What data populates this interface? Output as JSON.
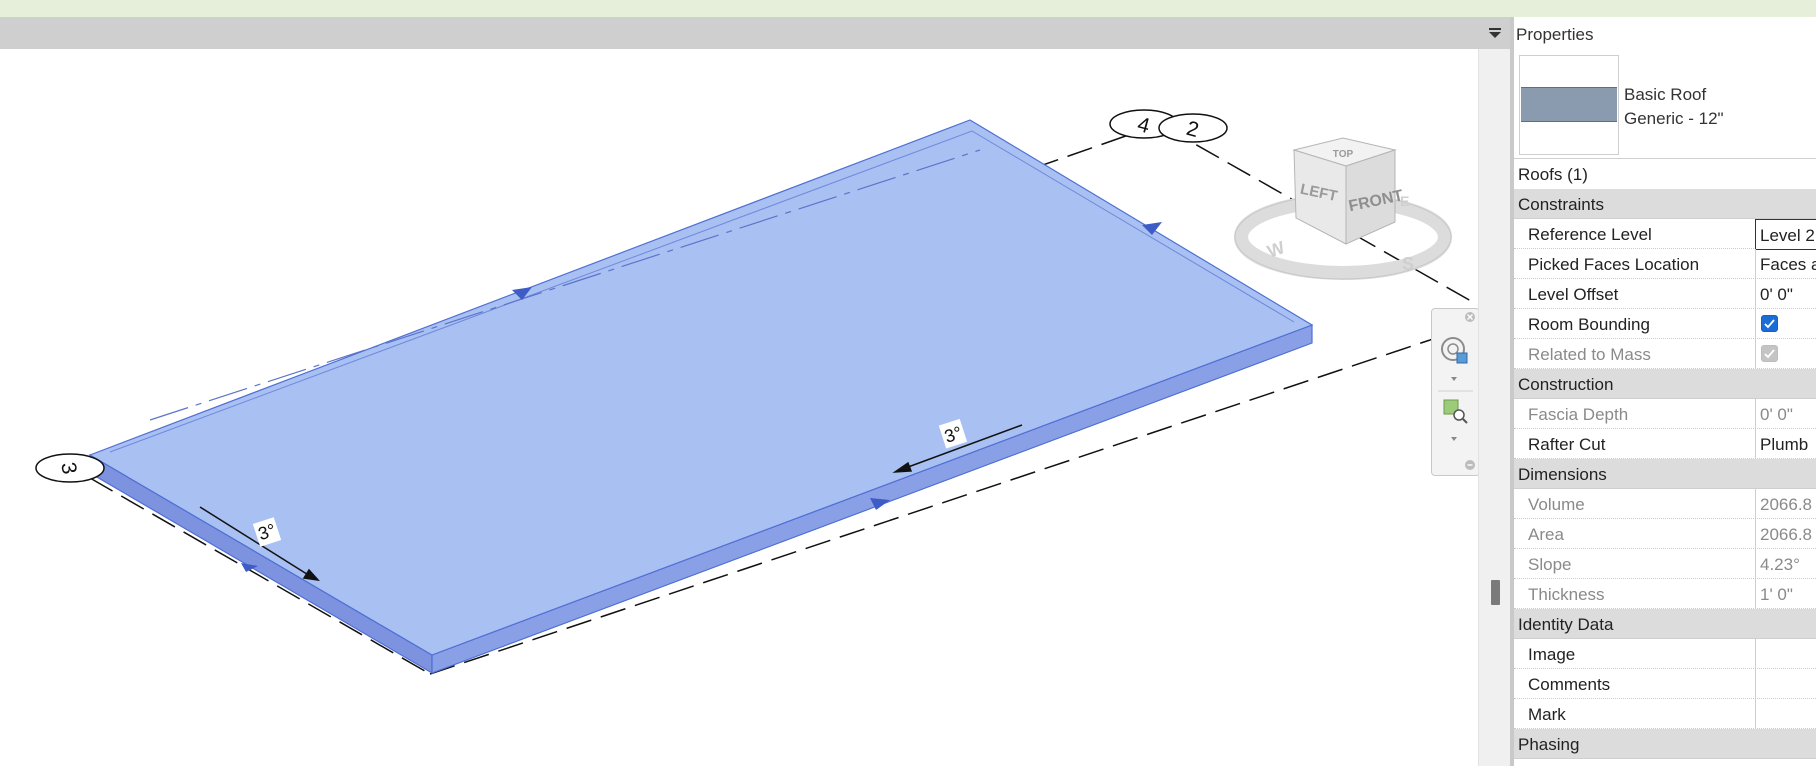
{
  "properties": {
    "title": "Properties",
    "type_family": "Basic Roof",
    "type_name": "Generic - 12\"",
    "selection": "Roofs (1)",
    "groups": [
      {
        "name": "Constraints",
        "rows": [
          {
            "label": "Reference Level",
            "value": "Level 2",
            "editing": true
          },
          {
            "label": "Picked Faces Location",
            "value": "Faces a"
          },
          {
            "label": "Level Offset",
            "value": "0'  0\""
          },
          {
            "label": "Room Bounding",
            "checkbox": "checked"
          },
          {
            "label": "Related to Mass",
            "checkbox": "disabled",
            "readonly": true
          }
        ]
      },
      {
        "name": "Construction",
        "rows": [
          {
            "label": "Fascia Depth",
            "value": "0'  0\"",
            "readonly": true
          },
          {
            "label": "Rafter Cut",
            "value": "Plumb"
          }
        ]
      },
      {
        "name": "Dimensions",
        "rows": [
          {
            "label": "Volume",
            "value": "2066.8",
            "readonly": true
          },
          {
            "label": "Area",
            "value": "2066.8",
            "readonly": true
          },
          {
            "label": "Slope",
            "value": "4.23°",
            "readonly": true
          },
          {
            "label": "Thickness",
            "value": "1'  0\"",
            "readonly": true
          }
        ]
      },
      {
        "name": "Identity Data",
        "rows": [
          {
            "label": "Image",
            "value": ""
          },
          {
            "label": "Comments",
            "value": ""
          },
          {
            "label": "Mark",
            "value": ""
          }
        ]
      },
      {
        "name": "Phasing",
        "rows": []
      }
    ]
  },
  "viewport": {
    "grid_labels": [
      "4",
      "2",
      "3"
    ],
    "slope_labels": [
      "3°",
      "3°"
    ],
    "roof_color": "#a9c0f2",
    "roof_edge_color": "#4f6fd4"
  },
  "viewcube": {
    "top": "TOP",
    "left": "LEFT",
    "front": "FRONT",
    "compass": [
      "W",
      "S",
      "E"
    ]
  }
}
